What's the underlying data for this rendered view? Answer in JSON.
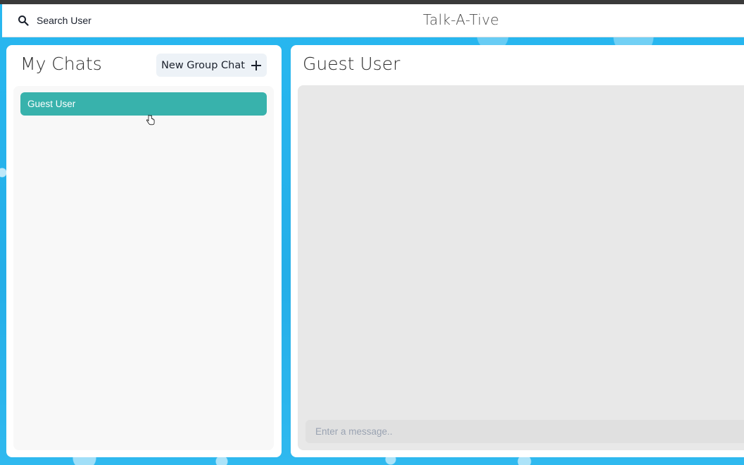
{
  "header": {
    "search_label": "Search User",
    "app_title": "Talk-A-Tive"
  },
  "sidebar": {
    "title": "My Chats",
    "new_group_label": "New Group Chat",
    "chats": [
      {
        "name": "Guest User",
        "selected": true
      }
    ]
  },
  "chat": {
    "title": "Guest User",
    "input_placeholder": "Enter a message.."
  },
  "colors": {
    "accent": "#38b2ac",
    "background": "#2bb5ee"
  },
  "icons": {
    "search": "search-icon",
    "add": "plus-icon"
  }
}
